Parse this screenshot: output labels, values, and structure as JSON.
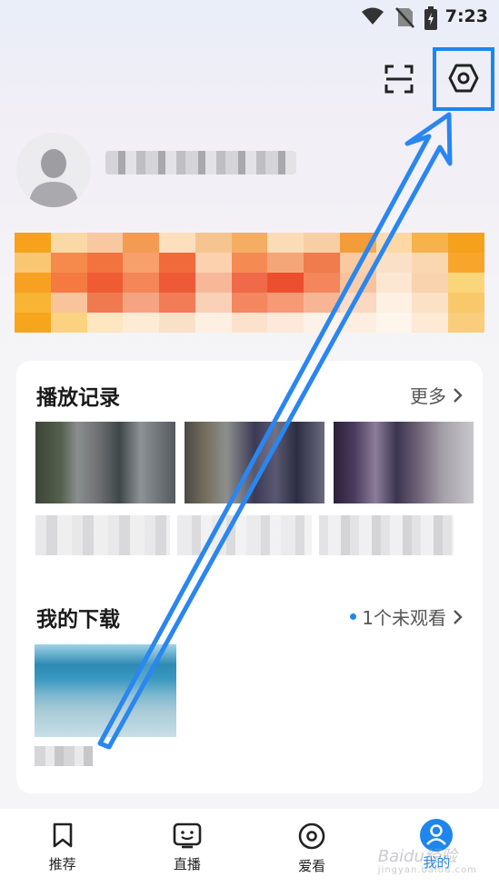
{
  "status_bar": {
    "time": "7:23"
  },
  "icons": {
    "scan": "scan-icon",
    "settings": "settings-hexagon-icon",
    "wifi": "wifi-icon",
    "signal": "no-signal-icon",
    "battery": "battery-charging-icon"
  },
  "colors": {
    "accent": "#1e86ec",
    "card_bg": "#ffffff",
    "page_bg": "#f5f5f7"
  },
  "history": {
    "title": "播放记录",
    "more_label": "更多"
  },
  "downloads": {
    "title": "我的下载",
    "unwatched_label": "1个未观看"
  },
  "tabs": [
    {
      "label": "推荐",
      "icon": "bookmark-icon",
      "active": false
    },
    {
      "label": "直播",
      "icon": "tv-face-icon",
      "active": false
    },
    {
      "label": "爱看",
      "icon": "target-circle-icon",
      "active": false
    },
    {
      "label": "我的",
      "icon": "profile-icon",
      "active": true
    }
  ],
  "watermark": {
    "text": "Baidu经验",
    "sub": "jingyan.baidu.com"
  }
}
